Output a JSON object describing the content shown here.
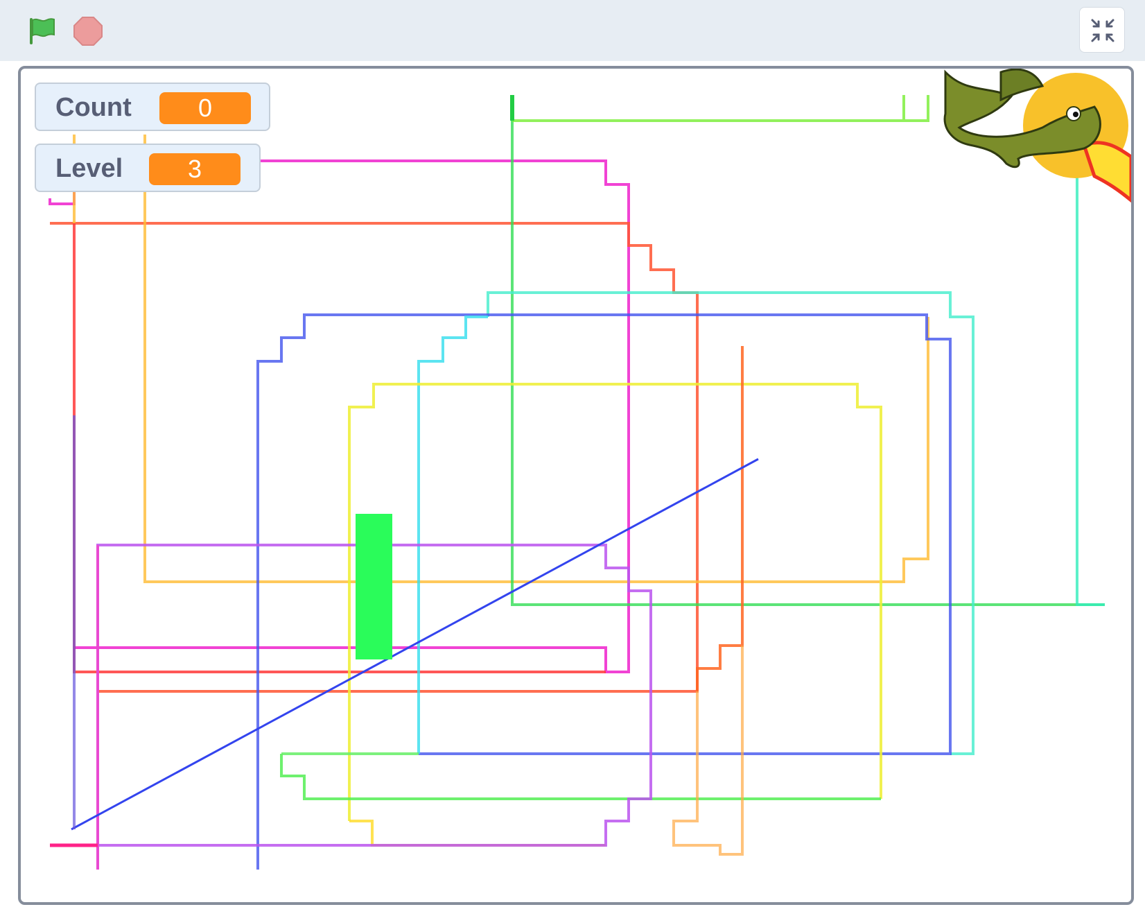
{
  "toolbar": {
    "green_flag_icon": "green-flag-icon",
    "stop_icon": "stop-icon",
    "fullscreen_exit_icon": "unfullscreen-icon"
  },
  "monitors": [
    {
      "label": "Count",
      "value": "0"
    },
    {
      "label": "Level",
      "value": "3"
    }
  ],
  "stage": {
    "sprites": [
      {
        "name": "dragon",
        "icon": "dragon-sprite"
      },
      {
        "name": "paddle",
        "color": "#2afc5a"
      }
    ]
  },
  "colors": {
    "monitor_value_bg": "#ff8c1a",
    "flag_green": "#4cbf56",
    "stop_red": "#ec9c9c"
  }
}
